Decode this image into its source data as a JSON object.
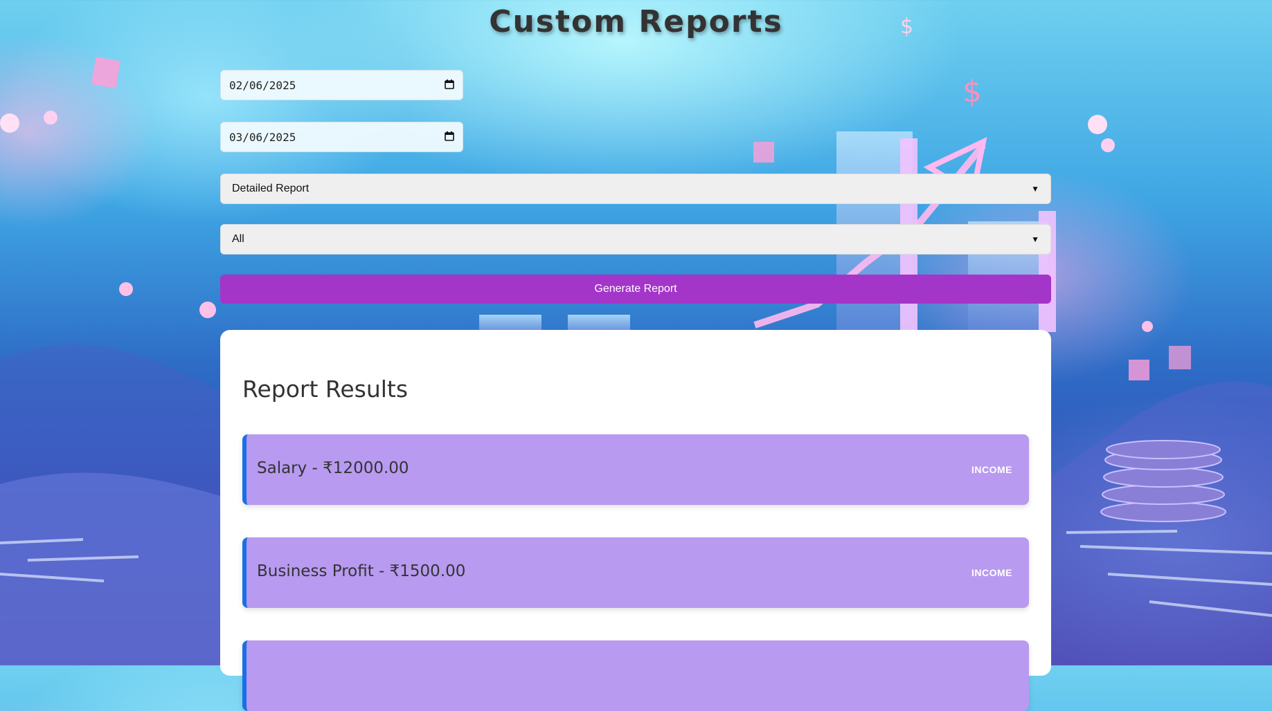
{
  "page": {
    "title": "Custom Reports"
  },
  "filters": {
    "start_date": "02/06/2025",
    "end_date": "03/06/2025",
    "report_type": "Detailed Report",
    "category": "All",
    "generate_label": "Generate Report"
  },
  "results": {
    "title": "Report Results",
    "items": [
      {
        "text": "Salary - ₹12000.00",
        "tag": "INCOME"
      },
      {
        "text": "Business Profit - ₹1500.00",
        "tag": "INCOME"
      },
      {
        "text": "",
        "tag": ""
      }
    ]
  },
  "colors": {
    "button": "#a435c9",
    "row_bg": "#b89af0",
    "row_accent": "#1a6ee8"
  },
  "icons": {
    "calendar": "calendar-icon",
    "chevron": "chevron-down-icon"
  }
}
